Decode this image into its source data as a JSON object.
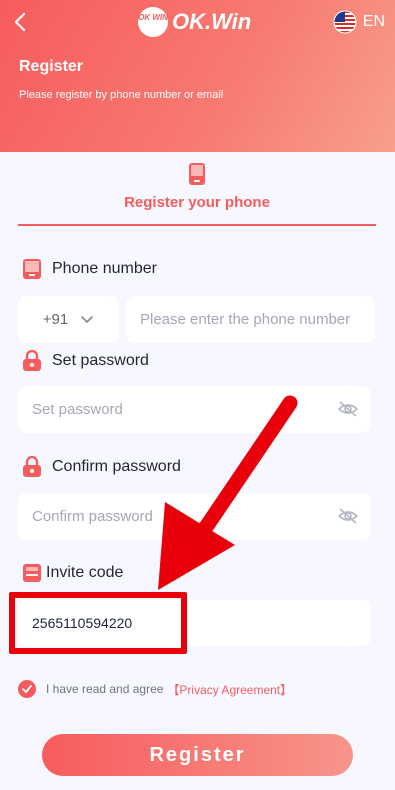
{
  "header": {
    "brand": "OK.Win",
    "badge_text": "OK WIN",
    "language": "EN",
    "title": "Register",
    "subtitle": "Please register by phone number or email"
  },
  "tab": {
    "label": "Register your phone"
  },
  "phone": {
    "label": "Phone number",
    "country_code": "+91",
    "placeholder": "Please enter the phone number"
  },
  "password": {
    "label": "Set password",
    "placeholder": "Set password"
  },
  "confirm": {
    "label": "Confirm password",
    "placeholder": "Confirm password"
  },
  "invite": {
    "label": "Invite code",
    "value": "2565110594220"
  },
  "agreement": {
    "text": "I have read and agree",
    "link": "【Privacy Agreement】"
  },
  "register_button": "Register",
  "colors": {
    "accent": "#f55c5d",
    "highlight": "#e8000b",
    "background": "#f7f8ff"
  }
}
